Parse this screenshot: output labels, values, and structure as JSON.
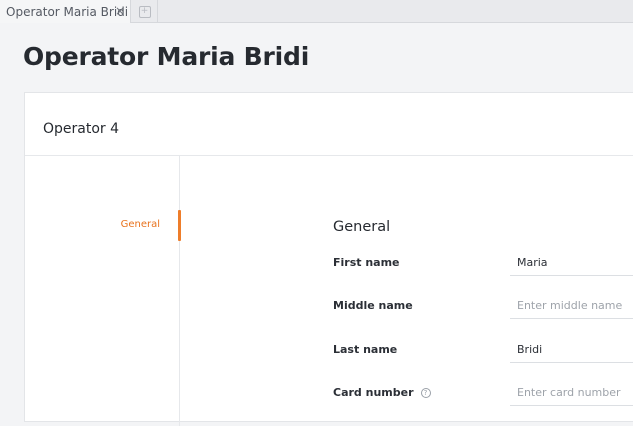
{
  "tabs": [
    {
      "label": "Operator Maria Bridi",
      "close_glyph": "×"
    }
  ],
  "newtab_glyph": "+",
  "page": {
    "title": "Operator Maria Bridi"
  },
  "card": {
    "title": "Operator 4",
    "nav": [
      {
        "label": "General",
        "active": true
      }
    ],
    "section_title": "General",
    "fields": {
      "first_name": {
        "label": "First name",
        "value": "Maria",
        "placeholder": ""
      },
      "middle_name": {
        "label": "Middle name",
        "value": "",
        "placeholder": "Enter middle name"
      },
      "last_name": {
        "label": "Last name",
        "value": "Bridi",
        "placeholder": ""
      },
      "card_number": {
        "label": "Card number",
        "value": "",
        "placeholder": "Enter card number",
        "help_glyph": "?"
      }
    }
  },
  "colors": {
    "accent": "#ee7d2a",
    "background": "#f3f4f6",
    "card": "#ffffff"
  }
}
